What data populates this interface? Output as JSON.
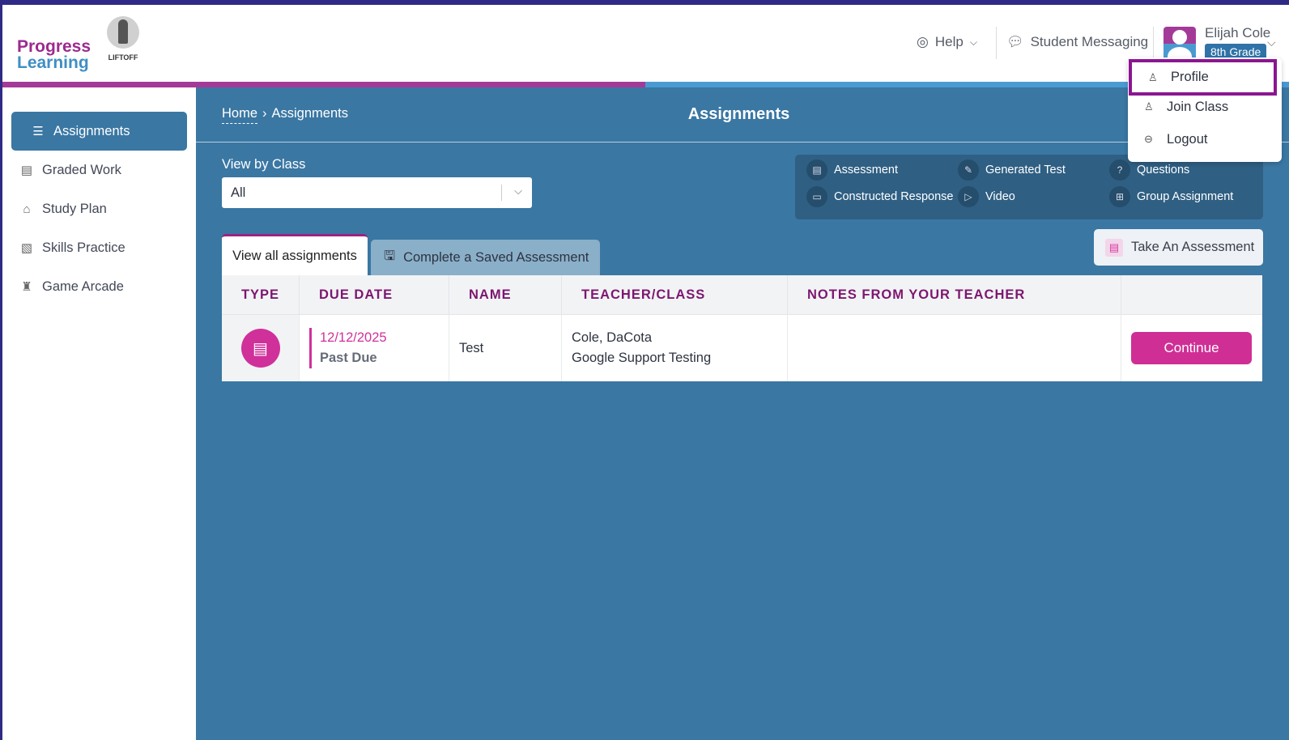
{
  "brand": {
    "logo_line1": "Progress",
    "logo_line2": "Learning",
    "partner_logo": "LIFTOFF",
    "colors": {
      "primary": "#3a77a3",
      "accent": "#cf2f95",
      "header_text": "#7d1670"
    }
  },
  "header": {
    "help": "Help",
    "messaging": "Student Messaging",
    "user_name": "Elijah Cole",
    "grade": "8th Grade"
  },
  "user_menu": {
    "items": [
      {
        "label": "Profile",
        "icon": "user-icon"
      },
      {
        "label": "Join Class",
        "icon": "user-icon"
      },
      {
        "label": "Logout",
        "icon": "logout-icon"
      }
    ]
  },
  "sidebar": {
    "items": [
      {
        "label": "Assignments",
        "icon": "stack-icon",
        "active": true
      },
      {
        "label": "Graded Work",
        "icon": "graded-icon"
      },
      {
        "label": "Study Plan",
        "icon": "book-icon"
      },
      {
        "label": "Skills Practice",
        "icon": "practice-icon"
      },
      {
        "label": "Game Arcade",
        "icon": "rocket-icon"
      }
    ]
  },
  "breadcrumb": {
    "home": "Home",
    "current": "Assignments"
  },
  "page_title": "Assignments",
  "filter": {
    "label": "View by Class",
    "value": "All"
  },
  "legend": [
    {
      "label": "Assessment",
      "icon": "list-icon"
    },
    {
      "label": "Generated Test",
      "icon": "edit-list-icon"
    },
    {
      "label": "Questions",
      "icon": "question-icon"
    },
    {
      "label": "Constructed Response",
      "icon": "monitor-icon"
    },
    {
      "label": "Video",
      "icon": "play-icon"
    },
    {
      "label": "Group Assignment",
      "icon": "group-add-icon"
    }
  ],
  "take_assessment": "Take An Assessment",
  "tabs": [
    {
      "label": "View all assignments",
      "active": true
    },
    {
      "label": "Complete a Saved Assessment"
    }
  ],
  "table": {
    "headers": [
      "TYPE",
      "DUE DATE",
      "NAME",
      "TEACHER/CLASS",
      "NOTES FROM YOUR TEACHER",
      ""
    ],
    "rows": [
      {
        "type": "assessment",
        "due_date": "12/12/2025",
        "status": "Past Due",
        "name": "Test",
        "teacher": "Cole, DaCota",
        "class": "Google Support Testing",
        "notes": "",
        "action": "Continue"
      }
    ]
  }
}
